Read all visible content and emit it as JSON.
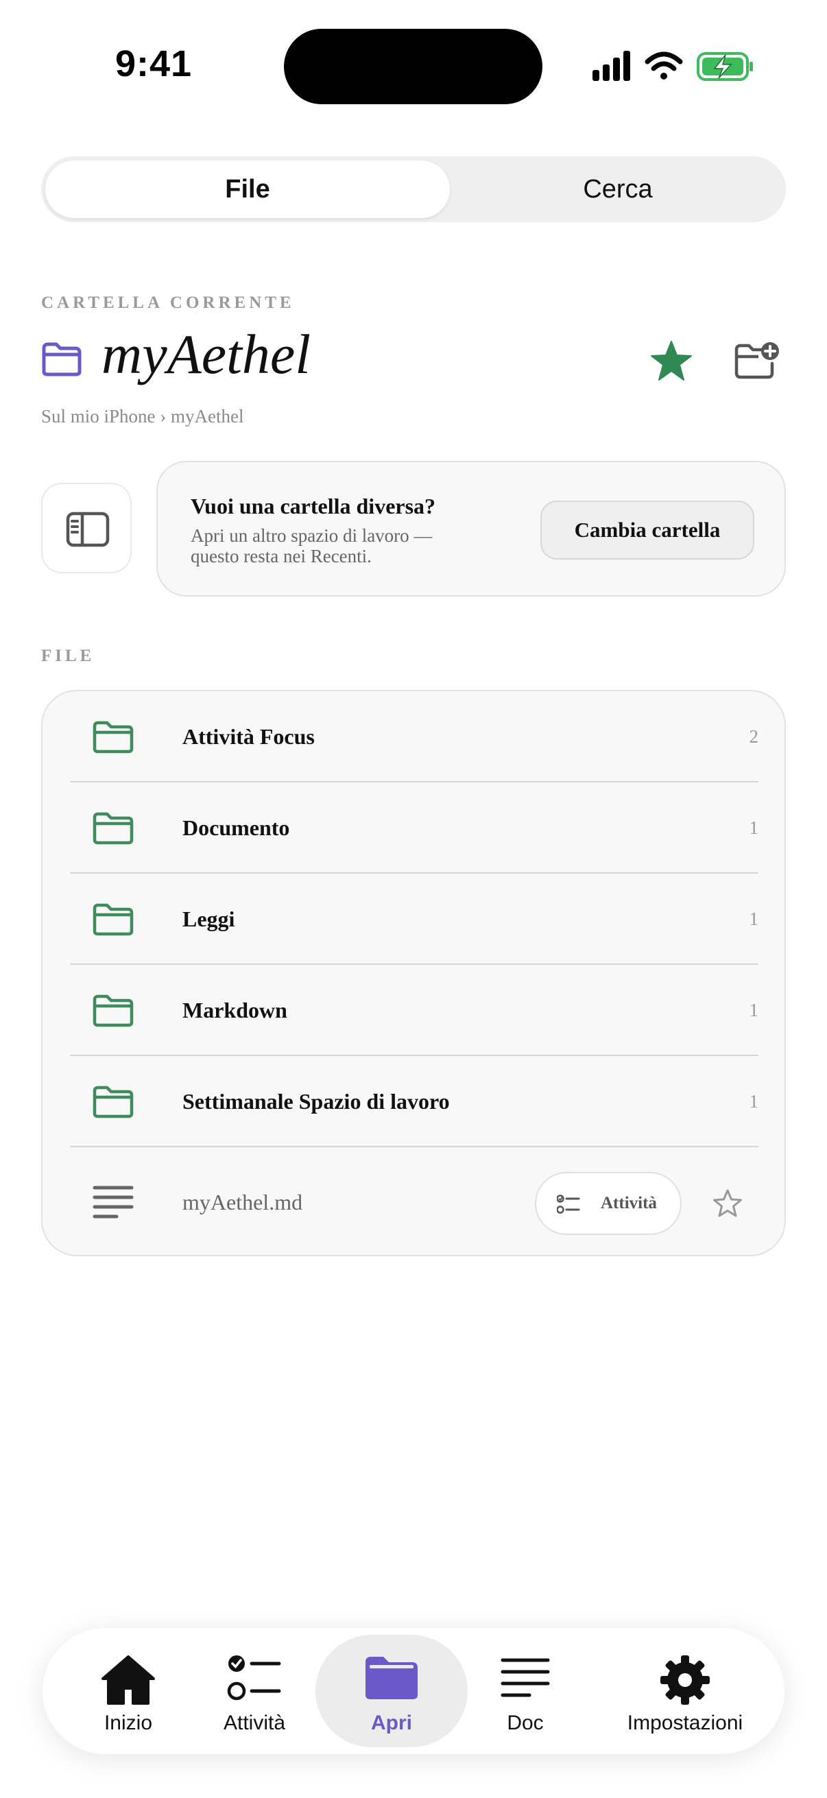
{
  "status_bar": {
    "time": "9:41"
  },
  "segmented": {
    "file_label": "File",
    "search_label": "Cerca"
  },
  "current_folder": {
    "section_label": "CARTELLA CORRENTE",
    "name": "myAethel",
    "breadcrumb": "Sul mio iPhone › myAethel",
    "favorite": true
  },
  "change_folder": {
    "title": "Vuoi una cartella diversa?",
    "subtitle": "Apri un altro spazio di lavoro — questo resta nei Recenti.",
    "button_label": "Cambia cartella"
  },
  "files": {
    "section_label": "FILE",
    "folders": [
      {
        "name": "Attività Focus",
        "count": "2"
      },
      {
        "name": "Documento",
        "count": "1"
      },
      {
        "name": "Leggi",
        "count": "1"
      },
      {
        "name": "Markdown",
        "count": "1"
      },
      {
        "name": "Settimanale Spazio di lavoro",
        "count": "1"
      }
    ],
    "document": {
      "name": "myAethel.md",
      "tasks_label": "Attività"
    }
  },
  "tabbar": {
    "items": [
      {
        "label": "Inizio",
        "icon": "house-icon"
      },
      {
        "label": "Attività",
        "icon": "checklist-icon"
      },
      {
        "label": "Apri",
        "icon": "folder-icon",
        "active": true
      },
      {
        "label": "Doc",
        "icon": "lines-icon"
      },
      {
        "label": "Impostazioni",
        "icon": "gear-icon"
      }
    ]
  },
  "colors": {
    "accent": "#6b58c9",
    "folder_green": "#3e8b5c",
    "star_green": "#2e8a52"
  }
}
